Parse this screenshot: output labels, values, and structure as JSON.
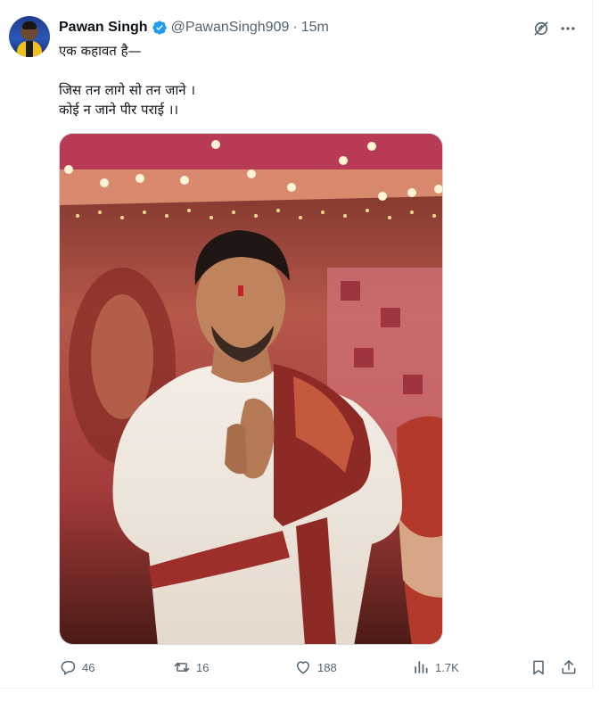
{
  "tweet": {
    "author_name": "Pawan Singh",
    "handle": "@PawanSingh909",
    "separator": "·",
    "time": "15m",
    "lines": [
      "एक कहावत है—",
      "जिस तन लागे सो तन जाने ।",
      "कोई न जाने पीर पराई ।।"
    ]
  },
  "actions": {
    "replies": "46",
    "reposts": "16",
    "likes": "188",
    "views": "1.7K"
  },
  "colors": {
    "verified": "#1d9bf0",
    "muted": "#536471",
    "text": "#0f1419"
  },
  "icons": {
    "verified": "verified-badge-icon",
    "grok": "grok-icon",
    "more": "more-dots-icon",
    "reply": "reply-icon",
    "repost": "repost-icon",
    "like": "heart-icon",
    "views": "views-bar-icon",
    "bookmark": "bookmark-icon",
    "share": "share-icon"
  }
}
